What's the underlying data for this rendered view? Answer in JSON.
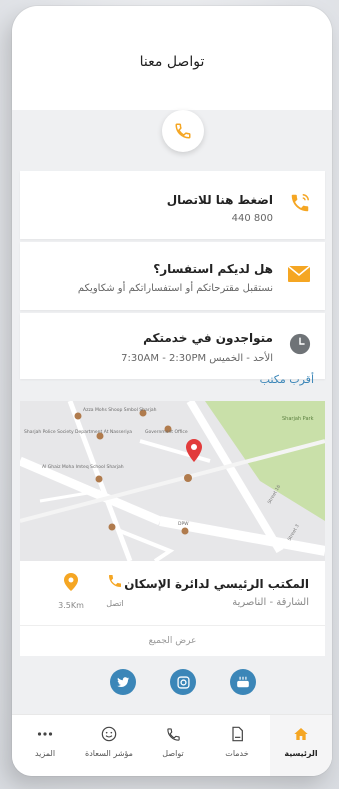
{
  "header": {
    "title": "تواصل معنا"
  },
  "cards": [
    {
      "title": "اضغط هنا للاتصال",
      "subtitle": "800 440",
      "icon": "phone-icon"
    },
    {
      "title": "هل لديكم استفسار؟",
      "subtitle": "نستقبل مقترحاتكم أو استفساراتكم أو شكاويكم",
      "icon": "mail-icon"
    },
    {
      "title": "متواجدون في خدمتكم",
      "subtitle": "الأحد - الخميس 7:30AM - 2:30PM",
      "icon": "clock-icon"
    }
  ],
  "nearest": {
    "title": "أقرب مكتب"
  },
  "map": {
    "labels": {
      "sharjah_park": "Sharjah Park",
      "school": "Azza Mohs Shoop Smbol Sharjah",
      "police": "Sharjah Police Society Department At Nasseriya",
      "gov_office": "Government Office",
      "kindergarten": "Al Ghaiz Moha Imteq School Sharjah",
      "dpw": "DPW",
      "street_a": "Street 16",
      "street_b": "Street 3"
    }
  },
  "office": {
    "name": "المكتب الرئيسي لدائرة الإسكان",
    "location": "الشارقة - الناصرية",
    "call_label": "اتصل",
    "distance_label": "3.5Km",
    "view_all": "عرض الجميع"
  },
  "social": [
    {
      "name": "twitter-icon"
    },
    {
      "name": "instagram-icon"
    },
    {
      "name": "youtube-icon"
    }
  ],
  "tabs": [
    {
      "label": "الرئيسية",
      "icon": "home-icon",
      "active": true
    },
    {
      "label": "خدمات",
      "icon": "services-icon"
    },
    {
      "label": "تواصل",
      "icon": "phone-icon"
    },
    {
      "label": "مؤشر السعادة",
      "icon": "smiley-icon"
    },
    {
      "label": "المزيد",
      "icon": "more-icon"
    }
  ],
  "colors": {
    "accent_orange": "#f5a623",
    "accent_blue": "#3b86b8",
    "map_green": "#c9e0a9",
    "pin_red": "#e23b3b"
  }
}
